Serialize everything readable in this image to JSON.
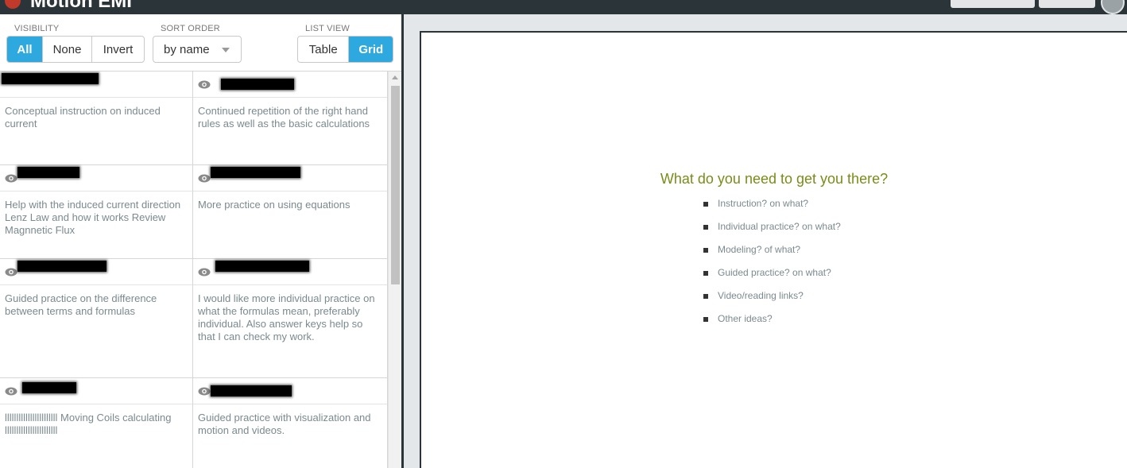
{
  "app": {
    "title": "Motion EMI"
  },
  "controls": {
    "visibility": {
      "label": "VISIBILITY",
      "options": [
        "All",
        "None",
        "Invert"
      ],
      "selected": "All"
    },
    "sort_order": {
      "label": "SORT ORDER",
      "value": "by name"
    },
    "list_view": {
      "label": "LIST VIEW",
      "options": [
        "Table",
        "Grid"
      ],
      "selected": "Grid"
    }
  },
  "responses": [
    {
      "text": "Conceptual instruction on induced current"
    },
    {
      "text": "Continued repetition of the right hand rules as well as the basic calculations"
    },
    {
      "text": "Help with the induced current direction Lenz Law and how it works Review Magnnetic Flux"
    },
    {
      "text": "More practice on using equations"
    },
    {
      "text": "Guided practice on the difference between terms and formulas"
    },
    {
      "text": "I would like more individual practice on what the formulas mean, preferably individual. Also answer keys help so that I can check my work."
    },
    {
      "text": "lllllllllllllllllllllll Moving Coils calculating lllllllllllllllllllllll"
    },
    {
      "text": "Guided practice with visualization and motion and videos."
    }
  ],
  "slide": {
    "title": "What do you need to get you there?",
    "items": [
      "Instruction? on what?",
      "Individual practice? on what?",
      "Modeling? of what?",
      "Guided practice? on what?",
      "Video/reading links?",
      "Other ideas?"
    ]
  },
  "colors": {
    "accent": "#2ea9df",
    "slide_title": "#7a8c18",
    "topbar": "#2b3539"
  },
  "icons": {
    "eye": "eye-icon",
    "dropdown": "chevron-down-icon"
  }
}
